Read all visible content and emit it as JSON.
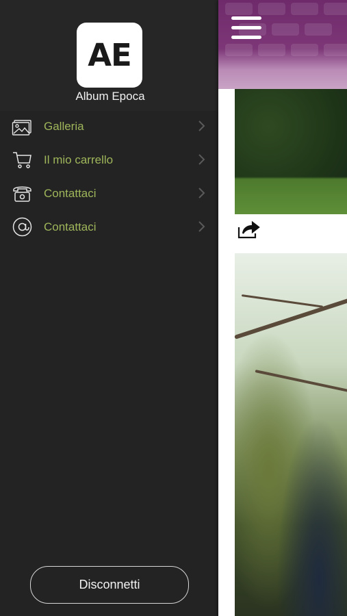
{
  "app": {
    "logo_text": "AE",
    "name": "Album Epoca"
  },
  "menu": {
    "items": [
      {
        "label": "Galleria",
        "icon": "gallery-icon"
      },
      {
        "label": "Il mio carrello",
        "icon": "cart-icon"
      },
      {
        "label": "Contattaci",
        "icon": "telephone-icon"
      },
      {
        "label": "Contattaci",
        "icon": "at-sign-icon"
      }
    ],
    "chevron_icon": "chevron-right-icon"
  },
  "logout": {
    "label": "Disconnetti"
  },
  "content": {
    "menu_icon": "hamburger-menu-icon",
    "share_icon": "share-icon"
  },
  "colors": {
    "drawer_bg": "#232323",
    "menu_label": "#9fb65a",
    "topbar": "#7d3778"
  }
}
